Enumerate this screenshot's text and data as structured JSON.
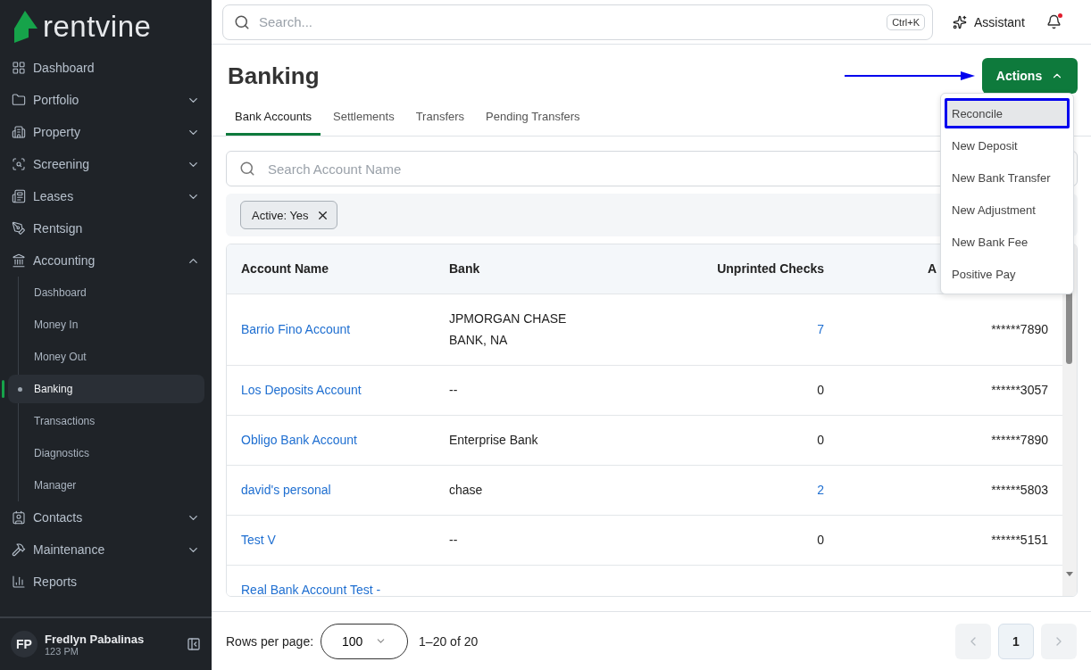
{
  "logo": {
    "text": "rentvine"
  },
  "sidebar": {
    "items": [
      {
        "label": "Dashboard"
      },
      {
        "label": "Portfolio",
        "expanded": false
      },
      {
        "label": "Property",
        "expanded": false
      },
      {
        "label": "Screening",
        "expanded": false
      },
      {
        "label": "Leases",
        "expanded": false
      },
      {
        "label": "Rentsign"
      },
      {
        "label": "Accounting",
        "expanded": true,
        "children": [
          {
            "label": "Dashboard",
            "selected": false
          },
          {
            "label": "Money In",
            "selected": false
          },
          {
            "label": "Money Out",
            "selected": false
          },
          {
            "label": "Banking",
            "selected": true
          },
          {
            "label": "Transactions",
            "selected": false
          },
          {
            "label": "Diagnostics",
            "selected": false
          },
          {
            "label": "Manager",
            "selected": false
          }
        ]
      },
      {
        "label": "Contacts",
        "expanded": false
      },
      {
        "label": "Maintenance",
        "expanded": false
      },
      {
        "label": "Reports"
      }
    ]
  },
  "user": {
    "initials": "FP",
    "name": "Fredlyn Pabalinas",
    "subtitle": "123 PM"
  },
  "topbar": {
    "search_placeholder": "Search...",
    "shortcut": "Ctrl+K",
    "assistant": "Assistant",
    "notification_dot": true
  },
  "page": {
    "title": "Banking",
    "actions_button": "Actions"
  },
  "actions_menu": [
    {
      "label": "Reconcile",
      "highlighted": true
    },
    {
      "label": "New Deposit",
      "highlighted": false
    },
    {
      "label": "New Bank Transfer",
      "highlighted": false
    },
    {
      "label": "New Adjustment",
      "highlighted": false
    },
    {
      "label": "New Bank Fee",
      "highlighted": false
    },
    {
      "label": "Positive Pay",
      "highlighted": false
    }
  ],
  "tabs": [
    {
      "label": "Bank Accounts",
      "selected": true
    },
    {
      "label": "Settlements",
      "selected": false
    },
    {
      "label": "Transfers",
      "selected": false
    },
    {
      "label": "Pending Transfers",
      "selected": false
    }
  ],
  "account_search": {
    "placeholder": "Search Account Name"
  },
  "filters": [
    {
      "label": "Active: Yes"
    }
  ],
  "table": {
    "columns": [
      "Account Name",
      "Bank",
      "Unprinted Checks",
      "A"
    ],
    "rows": [
      {
        "name": "Barrio Fino Account",
        "bank": "JPMORGAN CHASE BANK, NA",
        "unprinted_checks": "7",
        "checks_link": true,
        "account": "******7890"
      },
      {
        "name": "Los Deposits Account",
        "bank": "--",
        "unprinted_checks": "0",
        "checks_link": false,
        "account": "******3057"
      },
      {
        "name": "Obligo Bank Account",
        "bank": "Enterprise Bank",
        "unprinted_checks": "0",
        "checks_link": false,
        "account": "******7890"
      },
      {
        "name": "david's personal",
        "bank": "chase",
        "unprinted_checks": "2",
        "checks_link": true,
        "account": "******5803"
      },
      {
        "name": "Test V",
        "bank": "--",
        "unprinted_checks": "0",
        "checks_link": false,
        "account": "******5151"
      },
      {
        "name": "Real Bank Account Test -"
      }
    ]
  },
  "pagination": {
    "rows_per_page_label": "Rows per page:",
    "rows_per_page": "100",
    "range": "1–20 of 20",
    "pages": [
      {
        "label": "1",
        "selected": true
      }
    ],
    "prev_disabled": true,
    "next_disabled": true
  }
}
